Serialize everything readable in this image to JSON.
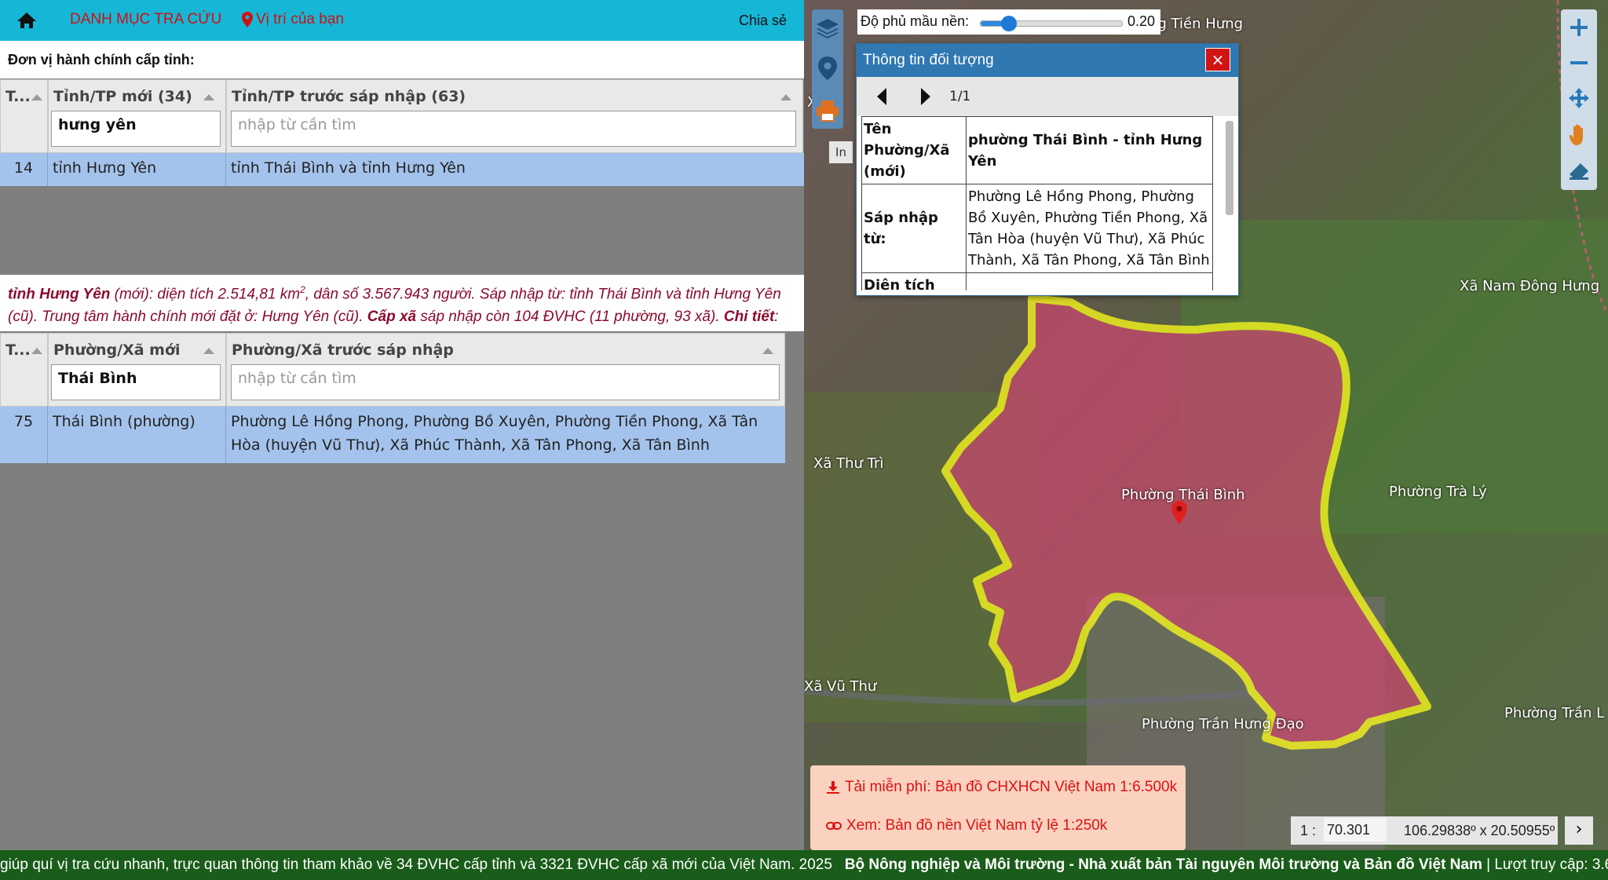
{
  "topbar": {
    "menu_label": "DANH MỤC TRA CỨU",
    "location_label": "Vị trí của bạn",
    "share_label": "Chia sẻ"
  },
  "province_section": {
    "title": "Đơn vị hành chính cấp tỉnh:",
    "col_index": "T...",
    "col_new": "Tỉnh/TP mới (34)",
    "col_old": "Tỉnh/TP trước sáp nhập (63)",
    "filter_new_value": "hưng yên",
    "filter_old_placeholder": "nhập từ cần tìm",
    "rows": [
      {
        "index": "14",
        "new": "tỉnh Hưng Yên",
        "old": "tỉnh Thái Bình và tỉnh Hưng Yên"
      }
    ]
  },
  "info_text": {
    "name": "tỉnh Hưng Yên",
    "p1": " (mới): diện tích 2.514,81 km",
    "sup": "2",
    "p2": ", dân số 3.567.943 người. Sáp nhập từ: tỉnh Thái Bình và tỉnh Hưng Yên (cũ). Trung tâm hành chính mới đặt ở: Hưng Yên (cũ). ",
    "level": "Cấp xã",
    "p3": " sáp nhập còn 104 ĐVHC (11 phường, 93 xã). ",
    "detail": "Chi tiết",
    "colon": ":"
  },
  "ward_section": {
    "col_index": "T...",
    "col_new": "Phường/Xã mới",
    "col_old": "Phường/Xã trước sáp nhập",
    "filter_new_value": "Thái Bình",
    "filter_old_placeholder": "nhập từ cần tìm",
    "rows": [
      {
        "index": "75",
        "new": "Thái Bình (phường)",
        "old": "Phường Lê Hồng Phong, Phường Bồ Xuyên, Phường Tiền Phong, Xã Tân Hòa (huyện Vũ Thư), Xã Phúc Thành, Xã Tân Phong, Xã Tân Bình"
      }
    ]
  },
  "map": {
    "opacity_label": "Độ phủ mầu nền:",
    "opacity_value": "0.20",
    "opacity_fraction": 0.2,
    "print_label": "In",
    "labels": {
      "dong_tien_hung": "Xã Đông Tiền Hưng",
      "nam_dong_hung": "Xã Nam Đông Hưng",
      "thu_tri": "Xã Thư Trì",
      "thai_binh": "Phường Thái Bình",
      "tra_ly": "Phường Trà Lý",
      "vu_thu": "Xã Vũ Thư",
      "tran_hung_dao": "Phường Trần Hưng Đạo",
      "tran_lam": "Phường Trần L",
      "edge_left": "Xã"
    },
    "highlight_color": "#ffff1a",
    "region_color": "#c8476e"
  },
  "popup": {
    "title": "Thông tin đối tượng",
    "close_label": "×",
    "page": "1/1",
    "rows": [
      {
        "key": "Tên Phường/Xã (mới)",
        "value": "phường Thái Bình - tỉnh Hưng Yên"
      },
      {
        "key": "Sáp nhập từ:",
        "value": "Phường Lê Hồng Phong, Phường Bồ Xuyên, Phường Tiền Phong, Xã Tân Hòa (huyện Vũ Thư), Xã Phúc Thành, Xã Tân Phong, Xã Tân Bình"
      },
      {
        "key": "Diện tích",
        "value": ""
      }
    ]
  },
  "promo": {
    "download": "Tải miễn phí: Bản đồ CHXHCN Việt Nam 1:6.500k",
    "view": "Xem: Bản đồ nền Việt Nam tỷ lệ 1:250k"
  },
  "scale": {
    "prefix": "1 :",
    "value": "70.301",
    "coords": "106.29838º x 20.50955º",
    "next": "›"
  },
  "bottombar": {
    "text": "giúp quí vị tra cứu nhanh, trực quan thông tin tham khảo về 34 ĐVHC cấp tỉnh và 3321 ĐVHC cấp xã mới của Việt Nam. 2025",
    "credit": "Bộ Nông nghiệp và Môi trường - Nhà xuất bản Tài nguyên Môi trường và Bản đồ Việt Nam",
    "visits": " | Lượt truy cập: 3.6"
  }
}
